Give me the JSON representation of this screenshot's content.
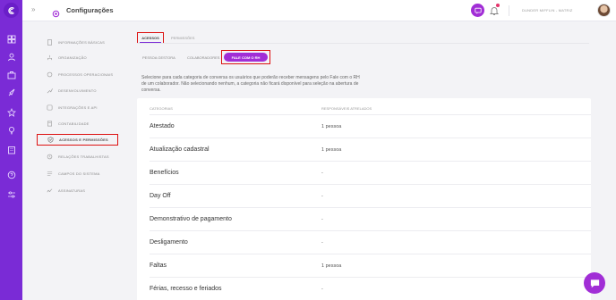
{
  "header": {
    "title": "Configurações",
    "collapse_glyph": "»",
    "user": "DUNDER MIFFLIN - MATRIZ",
    "chat_icon": "chat-icon",
    "bell_icon": "bell-icon"
  },
  "rail": {
    "icons": [
      "logo-icon",
      "grid-icon",
      "user-icon",
      "briefcase-icon",
      "rocket-icon",
      "star-icon",
      "lightbulb-icon",
      "building-icon",
      "help-icon",
      "sliders-icon"
    ],
    "color": "#7a2bd6"
  },
  "menu": {
    "items": [
      {
        "label": "INFORMAÇÕES BÁSICAS",
        "icon": "document-icon"
      },
      {
        "label": "ORGANIZAÇÃO",
        "icon": "org-icon"
      },
      {
        "label": "PROCESSOS OPERACIONAIS",
        "icon": "process-icon"
      },
      {
        "label": "DESENVOLVIMENTO",
        "icon": "development-icon"
      },
      {
        "label": "INTEGRAÇÕES E API",
        "icon": "integration-icon"
      },
      {
        "label": "CONTABILIDADE",
        "icon": "accounting-icon"
      },
      {
        "label": "ACESSOS E PERMISSÕES",
        "icon": "shield-check-icon",
        "active": true
      },
      {
        "label": "RELAÇÕES TRABALHISTAS",
        "icon": "labor-icon"
      },
      {
        "label": "CAMPOS DO SISTEMA",
        "icon": "fields-icon"
      },
      {
        "label": "ASSINATURAS",
        "icon": "signature-icon"
      }
    ]
  },
  "tabs": {
    "primary": [
      "ACESSOS",
      "PERMISSÕES"
    ],
    "secondary": [
      "PESSOA GESTORA",
      "COLABORADORES",
      "FALE COM O RH"
    ]
  },
  "description": "Selecione para cada categoria de conversa os usuários que poderão receber mensagens pelo Fale com o RH de um colaborador. Não selecionando nenhum, a categoria não ficará disponível para seleção na abertura de conversa.",
  "table": {
    "columns": [
      "CATEGORIAS",
      "RESPONSÁVEIS ATRELADOS"
    ],
    "rows": [
      {
        "category": "Atestado",
        "responsible": "1 pessoa"
      },
      {
        "category": "Atualização cadastral",
        "responsible": "1 pessoa"
      },
      {
        "category": "Benefícios",
        "responsible": "-"
      },
      {
        "category": "Day Off",
        "responsible": "-"
      },
      {
        "category": "Demonstrativo de pagamento",
        "responsible": "-"
      },
      {
        "category": "Desligamento",
        "responsible": "-"
      },
      {
        "category": "Faltas",
        "responsible": "1 pessoa"
      },
      {
        "category": "Férias, recesso e feriados",
        "responsible": "-"
      }
    ]
  },
  "colors": {
    "accent": "#a12ed6",
    "highlight": "#dd1111"
  }
}
